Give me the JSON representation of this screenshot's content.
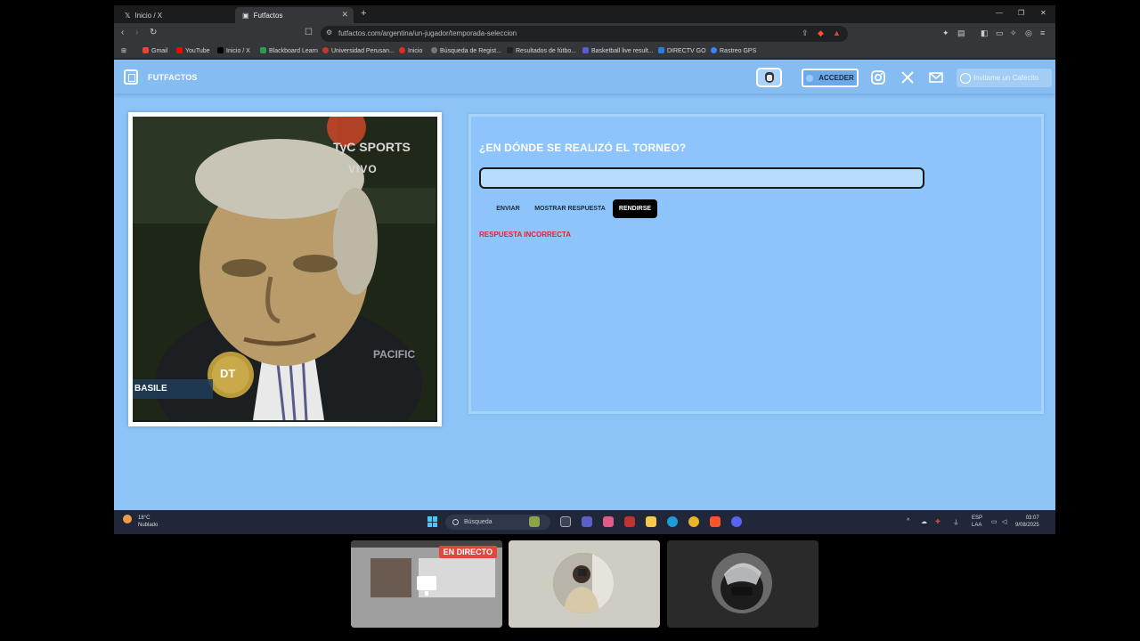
{
  "browser": {
    "tabs": [
      {
        "label": "Inicio / X",
        "icon": "x-logo-icon"
      },
      {
        "label": "Futfactos",
        "icon": "futfactos-logo-icon",
        "active": true
      }
    ],
    "url": "futfactos.com/argentina/un-jugador/temporada-seleccion",
    "bookmarks": [
      {
        "label": "Gmail",
        "color": "#ea4335"
      },
      {
        "label": "YouTube",
        "color": "#ff0000"
      },
      {
        "label": "Inicio / X",
        "color": "#000000"
      },
      {
        "label": "Blackboard Learn",
        "color": "#2a9d55"
      },
      {
        "label": "Universidad Perusan...",
        "color": "#c0392b"
      },
      {
        "label": "Inicio",
        "color": "#d93025"
      },
      {
        "label": "Búsqueda de Regist...",
        "color": "#777777"
      },
      {
        "label": "Resultados de fútbo...",
        "color": "#222222"
      },
      {
        "label": "Basketball live result...",
        "color": "#5b5bd6"
      },
      {
        "label": "DIRECTV GO",
        "color": "#2a7de1"
      },
      {
        "label": "Rastreo GPS",
        "color": "#3b82f6"
      }
    ]
  },
  "site": {
    "brand": "FUTFACTOS",
    "login_label": "ACCEDER",
    "coffee_label": "Invitame un Cafecito"
  },
  "photo": {
    "channel": "TyC SPORTS",
    "live_tag": "VIVO",
    "caption_name": "BASILE",
    "badge": "DT",
    "bg_text": "PACIFIC"
  },
  "quiz": {
    "question": "¿EN DÓNDE SE REALIZÓ EL TORNEO?",
    "answer_value": "",
    "send_label": "ENVIAR",
    "show_label": "MOSTRAR RESPUESTA",
    "giveup_label": "RENDIRSE",
    "feedback": "RESPUESTA INCORRECTA",
    "feedback_color": "#e8202b"
  },
  "taskbar": {
    "temperature": "18°C",
    "weather": "Nublado",
    "search_placeholder": "Búsqueda",
    "language": "ESP",
    "layout": "LAA",
    "time": "03:07",
    "date": "9/08/2025"
  },
  "call": {
    "live_label": "EN DIRECTO"
  }
}
